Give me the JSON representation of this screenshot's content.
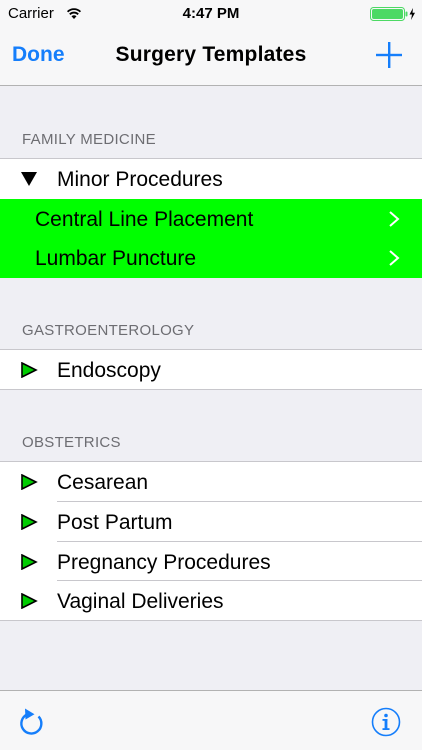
{
  "status_bar": {
    "carrier": "Carrier",
    "time": "4:47 PM"
  },
  "nav": {
    "done_label": "Done",
    "title": "Surgery Templates"
  },
  "sections": [
    {
      "header": "FAMILY MEDICINE",
      "groups": [
        {
          "label": "Minor Procedures",
          "expanded": true,
          "items": [
            "Central Line Placement",
            "Lumbar Puncture"
          ]
        }
      ]
    },
    {
      "header": "GASTROENTEROLOGY",
      "groups": [
        {
          "label": "Endoscopy",
          "expanded": false
        }
      ]
    },
    {
      "header": "OBSTETRICS",
      "groups": [
        {
          "label": "Cesarean",
          "expanded": false
        },
        {
          "label": "Post Partum",
          "expanded": false
        },
        {
          "label": "Pregnancy Procedures",
          "expanded": false
        },
        {
          "label": "Vaginal Deliveries",
          "expanded": false
        }
      ]
    }
  ],
  "toolbar": {
    "left_icon": "refresh-icon",
    "right_icon": "info-icon"
  },
  "colors": {
    "accent": "#157efb",
    "highlight": "#00ff00",
    "background": "#efeff4",
    "collapsed_triangle": "#00cc00"
  }
}
